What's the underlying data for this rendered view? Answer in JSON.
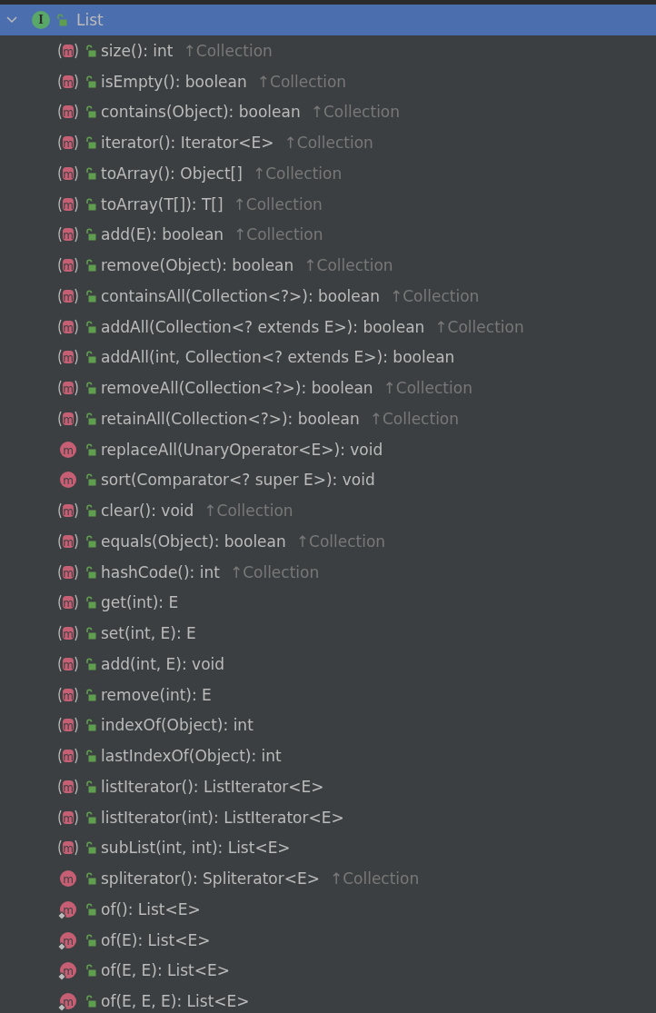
{
  "root": {
    "badge": "I",
    "name": "List",
    "expanded": true,
    "selected": true
  },
  "members": [
    {
      "kind": "abstract",
      "badge": "m",
      "signature": "size(): int",
      "origin": "↑Collection"
    },
    {
      "kind": "abstract",
      "badge": "m",
      "signature": "isEmpty(): boolean",
      "origin": "↑Collection"
    },
    {
      "kind": "abstract",
      "badge": "m",
      "signature": "contains(Object): boolean",
      "origin": "↑Collection"
    },
    {
      "kind": "abstract",
      "badge": "m",
      "signature": "iterator(): Iterator<E>",
      "origin": "↑Collection"
    },
    {
      "kind": "abstract",
      "badge": "m",
      "signature": "toArray(): Object[]",
      "origin": "↑Collection"
    },
    {
      "kind": "abstract",
      "badge": "m",
      "signature": "toArray(T[]): T[]",
      "origin": "↑Collection"
    },
    {
      "kind": "abstract",
      "badge": "m",
      "signature": "add(E): boolean",
      "origin": "↑Collection"
    },
    {
      "kind": "abstract",
      "badge": "m",
      "signature": "remove(Object): boolean",
      "origin": "↑Collection"
    },
    {
      "kind": "abstract",
      "badge": "m",
      "signature": "containsAll(Collection<?>): boolean",
      "origin": "↑Collection"
    },
    {
      "kind": "abstract",
      "badge": "m",
      "signature": "addAll(Collection<? extends E>): boolean",
      "origin": "↑Collection"
    },
    {
      "kind": "abstract",
      "badge": "m",
      "signature": "addAll(int, Collection<? extends E>): boolean"
    },
    {
      "kind": "abstract",
      "badge": "m",
      "signature": "removeAll(Collection<?>): boolean",
      "origin": "↑Collection"
    },
    {
      "kind": "abstract",
      "badge": "m",
      "signature": "retainAll(Collection<?>): boolean",
      "origin": "↑Collection"
    },
    {
      "kind": "default",
      "badge": "m",
      "signature": "replaceAll(UnaryOperator<E>): void"
    },
    {
      "kind": "default",
      "badge": "m",
      "signature": "sort(Comparator<? super E>): void"
    },
    {
      "kind": "abstract",
      "badge": "m",
      "signature": "clear(): void",
      "origin": "↑Collection"
    },
    {
      "kind": "abstract",
      "badge": "m",
      "signature": "equals(Object): boolean",
      "origin": "↑Collection"
    },
    {
      "kind": "abstract",
      "badge": "m",
      "signature": "hashCode(): int",
      "origin": "↑Collection"
    },
    {
      "kind": "abstract",
      "badge": "m",
      "signature": "get(int): E"
    },
    {
      "kind": "abstract",
      "badge": "m",
      "signature": "set(int, E): E"
    },
    {
      "kind": "abstract",
      "badge": "m",
      "signature": "add(int, E): void"
    },
    {
      "kind": "abstract",
      "badge": "m",
      "signature": "remove(int): E"
    },
    {
      "kind": "abstract",
      "badge": "m",
      "signature": "indexOf(Object): int"
    },
    {
      "kind": "abstract",
      "badge": "m",
      "signature": "lastIndexOf(Object): int"
    },
    {
      "kind": "abstract",
      "badge": "m",
      "signature": "listIterator(): ListIterator<E>"
    },
    {
      "kind": "abstract",
      "badge": "m",
      "signature": "listIterator(int): ListIterator<E>"
    },
    {
      "kind": "abstract",
      "badge": "m",
      "signature": "subList(int, int): List<E>"
    },
    {
      "kind": "default",
      "badge": "m",
      "signature": "spliterator(): Spliterator<E>",
      "origin": "↑Collection"
    },
    {
      "kind": "static",
      "badge": "m",
      "signature": "of(): List<E>"
    },
    {
      "kind": "static",
      "badge": "m",
      "signature": "of(E): List<E>"
    },
    {
      "kind": "static",
      "badge": "m",
      "signature": "of(E, E): List<E>"
    },
    {
      "kind": "static",
      "badge": "m",
      "signature": "of(E, E, E): List<E>"
    }
  ]
}
